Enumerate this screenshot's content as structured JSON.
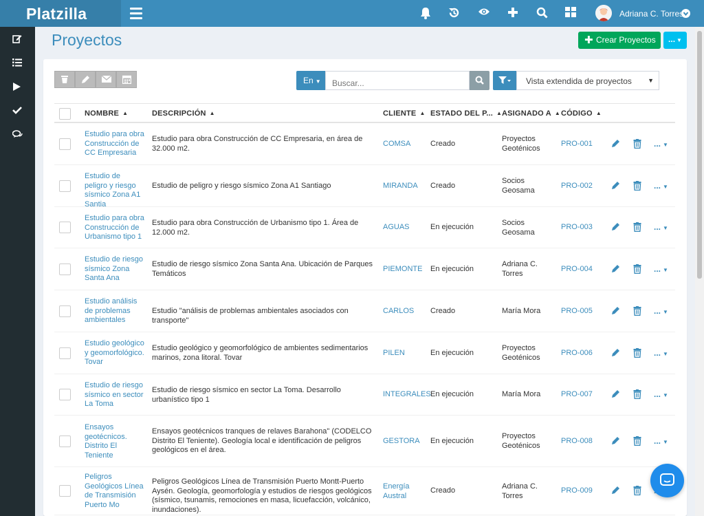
{
  "app": {
    "logo": "Platzilla"
  },
  "topbar": {
    "icons": [
      "bell-icon",
      "history-icon",
      "eye-icon",
      "plus-icon",
      "search-icon",
      "grid-icon"
    ],
    "user_name": "Adriana C. Torres"
  },
  "sidebar": {
    "icons": [
      "edit-icon",
      "list-icon",
      "play-icon",
      "check-icon",
      "comments-icon"
    ]
  },
  "header": {
    "title": "Proyectos",
    "create_label": "Crear Proyectos",
    "more_label": "..."
  },
  "toolbar": {
    "search_scope": "En",
    "search_placeholder": "Buscar...",
    "view_selected": "Vista extendida de proyectos"
  },
  "table": {
    "columns": [
      "NOMBRE",
      "DESCRIPCIÓN",
      "CLIENTE",
      "ESTADO DEL P...",
      "ASIGNADO A",
      "CÓDIGO"
    ],
    "more_label": "...",
    "rows": [
      {
        "name": "Estudio para obra Construcción de CC Empresaria",
        "description": "Estudio para obra Construcción de CC Empresaria, en área de 32.000 m2.",
        "client": "COMSA",
        "state": "Creado",
        "assigned": "Proyectos Geoténicos",
        "code": "PRO-001"
      },
      {
        "name": "Estudio de peligro y riesgo sísmico Zona A1 Santia",
        "description": "Estudio de peligro y riesgo sísmico Zona A1 Santiago",
        "client": "MIRANDA",
        "state": "Creado",
        "assigned": "Socios Geosama",
        "code": "PRO-002"
      },
      {
        "name": "Estudio para obra Construcción de Urbanismo tipo 1",
        "description": "Estudio para obra Construcción de Urbanismo tipo 1. Área de 12.000 m2.",
        "client": "AGUAS",
        "state": "En ejecución",
        "assigned": "Socios Geosama",
        "code": "PRO-003"
      },
      {
        "name": "Estudio de riesgo sísmico Zona Santa Ana",
        "description": "Estudio de riesgo sísmico Zona Santa Ana. Ubicación de Parques Temáticos",
        "client": "PIEMONTE",
        "state": "En ejecución",
        "assigned": "Adriana C. Torres",
        "code": "PRO-004"
      },
      {
        "name": "Estudio análisis de problemas ambientales",
        "description": "Estudio \"análisis de problemas ambientales asociados con transporte\"",
        "client": "CARLOS",
        "state": "Creado",
        "assigned": "María Mora",
        "code": "PRO-005"
      },
      {
        "name": "Estudio geológico y geomorfológico. Tovar",
        "description": "Estudio geológico y geomorfológico de ambientes sedimentarios marinos, zona litoral. Tovar",
        "client": "PILEN",
        "state": "En ejecución",
        "assigned": "Proyectos Geoténicos",
        "code": "PRO-006"
      },
      {
        "name": "Estudio de riesgo sísmico en sector La Toma",
        "description": "Estudio de riesgo sísmico en sector La Toma. Desarrollo urbanístico tipo 1",
        "client": "INTEGRALES",
        "state": "En ejecución",
        "assigned": "María Mora",
        "code": "PRO-007"
      },
      {
        "name": "Ensayos geotécnicos. Distrito El Teniente",
        "description": "Ensayos geotécnicos tranques de relaves Barahona\" (CODELCO Distrito El Teniente). Geología local e identificación de peligros geológicos en el área.",
        "client": "GESTORA",
        "state": "En ejecución",
        "assigned": "Proyectos Geoténicos",
        "code": "PRO-008"
      },
      {
        "name": "Peligros Geológicos Línea de Transmisión Puerto Mo",
        "description": "Peligros Geológicos Línea de Transmisión Puerto Montt-Puerto Aysén. Geología, geomorfología y estudios de riesgos geológicos (sísmico, tsunamis, remociones en masa, licuefacción, volcánico, inundaciones).",
        "client": "Energía Austral",
        "state": "Creado",
        "assigned": "Adriana C. Torres",
        "code": "PRO-009"
      }
    ]
  }
}
